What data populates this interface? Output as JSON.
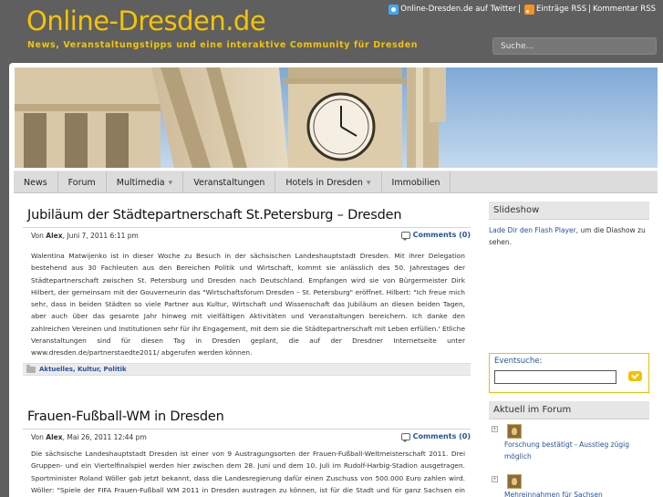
{
  "header": {
    "title": "Online-Dresden.de",
    "tagline": "News, Veranstaltungstipps und eine interaktive Community für Dresden",
    "links": {
      "twitter": "Online-Dresden.de auf Twitter",
      "sep1": "|",
      "entries_rss": "Einträge RSS",
      "sep2": "|",
      "comments_rss": "Kommentar RSS"
    },
    "search_placeholder": "Suche..."
  },
  "nav": {
    "items": [
      "News",
      "Forum",
      "Multimedia",
      "Veranstaltungen",
      "Hotels in Dresden",
      "Immobilien"
    ]
  },
  "posts": [
    {
      "title": "Jubiläum der Städtepartnerschaft St.Petersburg – Dresden",
      "meta_prefix": "Von",
      "author": "Alex",
      "date": ", Juni 7, 2011 6:11 pm",
      "comments": "Comments (0)",
      "body": "Walentina Matwijenko ist in dieser Woche zu Besuch in der sächsischen Landeshauptstadt Dresden. Mit ihrer Delegation bestehend aus 30 Fachleuten aus den Bereichen Politik und Wirtschaft, kommt sie anlässlich des 50. Jahrestages der Städtepartnerschaft zwischen St. Petersburg und Dresden nach Deutschland. Empfangen wird sie von Bürgermeister Dirk Hilbert, der gemeinsam mit der Gouverneurin das \"Wirtschaftsforum Dresden – St. Petersburg\" eröffnet. Hilbert: \"Ich freue mich sehr, dass in beiden Städten so viele Partner aus Kultur, Wirtschaft und Wissenschaft das Jubiläum an diesen beiden Tagen, aber auch über das gesamte Jahr hinweg mit vielfältigen Aktivitäten und Veranstaltungen bereichern. Ich danke den zahlreichen Vereinen und Institutionen sehr für ihr Engagement, mit dem sie die Städtepartnerschaft mit Leben erfüllen.' Etliche Veranstaltungen sind für diesen Tag in Dresden geplant, die auf der Dresdner Internetseite unter www.dresden.de/partnerstaedte2011/ abgerufen werden können.",
      "categories": "Aktuelles, Kultur, Politik"
    },
    {
      "title": "Frauen-Fußball-WM in Dresden",
      "meta_prefix": "Von",
      "author": "Alex",
      "date": ", Mai 26, 2011 12:44 pm",
      "comments": "Comments (0)",
      "body": "Die sächsische Landeshauptstadt Dresden ist einer von 9 Austragungsorten der Frauen-Fußball-Weltmeisterschaft 2011. Drei Gruppen- und ein Viertelfinalspiel werden hier zwischen dem 28. Juni und dem 10. Juli im Rudolf-Harbig-Stadion ausgetragen. Sportminister Roland Wöller gab jetzt bekannt, dass die Landesregierung dafür einen Zuschuss von 500.000 Euro zahlen wird. Wöller: \"Spiele der FIFA Frauen-Fußball WM 2011 in Dresden austragen zu können, ist für die Stadt und für ganz Sachsen ein internationales"
    }
  ],
  "sidebar": {
    "slideshow": {
      "title": "Slideshow",
      "link_text": "Lade Dir den Flash Player",
      "rest_text": ", um die Diashow zu sehen."
    },
    "event_search": {
      "label": "Eventsuche",
      "colon": ":"
    },
    "forum": {
      "title": "Aktuell im Forum",
      "items": [
        "Forschung bestätigt - Ausstieg zügig möglich",
        "Mehreinnahmen für Sachsen"
      ]
    }
  },
  "colors": {
    "brand_yellow": "#f5c400",
    "header_gray": "#5f5f5f",
    "link_blue": "#2553a0"
  }
}
